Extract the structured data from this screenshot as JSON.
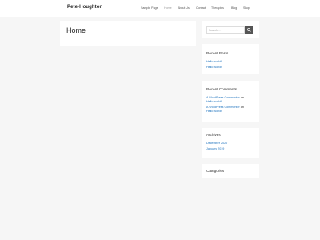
{
  "header": {
    "site_title": "Pete-Houghton",
    "nav": [
      "Sample Page",
      "Home",
      "About Us",
      "Contact",
      "Therapies",
      "Blog",
      "Shop"
    ]
  },
  "main": {
    "page_title": "Home"
  },
  "sidebar": {
    "search": {
      "placeholder": "Search …"
    },
    "recent_posts": {
      "title": "Recent Posts",
      "items": [
        "Hello world!",
        "Hello world!"
      ]
    },
    "recent_comments": {
      "title": "Recent Comments",
      "items": [
        {
          "author": "A WordPress Commenter",
          "on": "on",
          "post": "Hello world!"
        },
        {
          "author": "A WordPress Commenter",
          "on": "on",
          "post": "Hello world!"
        }
      ]
    },
    "archives": {
      "title": "Archives",
      "items": [
        "December 2020",
        "January 2019"
      ]
    },
    "categories": {
      "title": "Categories"
    }
  },
  "colors": {
    "link": "#1e73be",
    "background": "#f6f6f6"
  }
}
